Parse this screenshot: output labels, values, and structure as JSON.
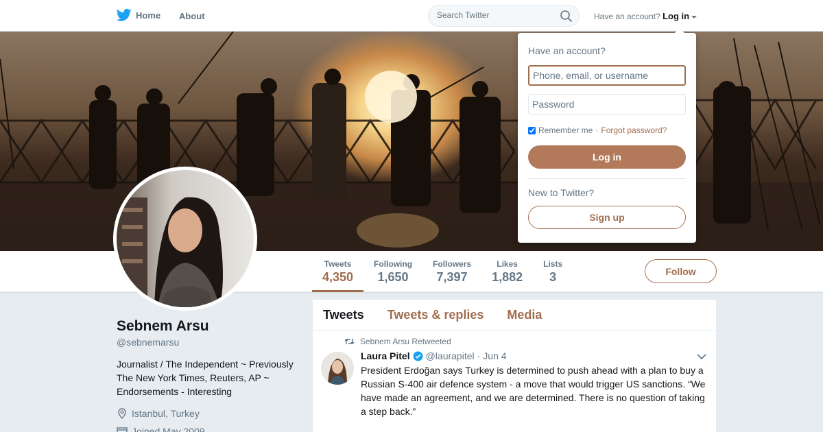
{
  "colors": {
    "accent": "#a26d4f",
    "twitter_blue": "#1da1f2"
  },
  "nav": {
    "home_label": "Home",
    "about_label": "About",
    "search_placeholder": "Search Twitter",
    "have_account_text": "Have an account?",
    "login_label": "Log in"
  },
  "login_dropdown": {
    "title": "Have an account?",
    "username_placeholder": "Phone, email, or username",
    "password_placeholder": "Password",
    "remember_label": "Remember me",
    "separator": "·",
    "forgot_label": "Forgot password?",
    "login_button": "Log in",
    "new_text": "New to Twitter?",
    "signup_button": "Sign up"
  },
  "profile": {
    "name": "Sebnem Arsu",
    "handle": "@sebnemarsu",
    "bio": "Journalist / The Independent ~ Previously The New York Times, Reuters, AP ~ Endorsements - Interesting",
    "location": "Istanbul, Turkey",
    "joined": "Joined May 2009"
  },
  "stats": [
    {
      "label": "Tweets",
      "value": "4,350"
    },
    {
      "label": "Following",
      "value": "1,650"
    },
    {
      "label": "Followers",
      "value": "7,397"
    },
    {
      "label": "Likes",
      "value": "1,882"
    },
    {
      "label": "Lists",
      "value": "3"
    }
  ],
  "follow_button": "Follow",
  "timeline": {
    "tabs": [
      "Tweets",
      "Tweets & replies",
      "Media"
    ],
    "tweet": {
      "context": "Sebnem Arsu Retweeted",
      "author": "Laura Pitel",
      "handle": "@laurapitel",
      "dot": "·",
      "date": "Jun 4",
      "text": "President Erdoğan says Turkey is determined to push ahead with a plan to buy a Russian S-400 air defence system - a move that would trigger US sanctions. “We have made an agreement, and we are determined. There is no question of taking a step back.”"
    }
  }
}
